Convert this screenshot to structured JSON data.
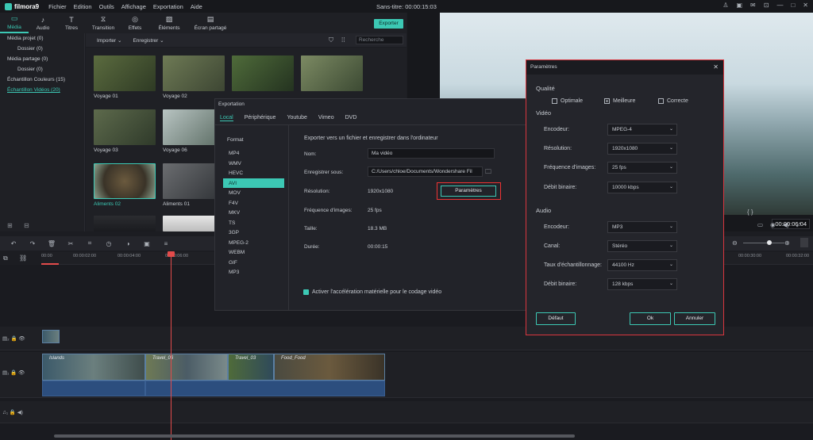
{
  "app": {
    "name": "filmora9",
    "title": "Sans-titre: 00:00:15:03"
  },
  "menu": [
    "Fichier",
    "Edition",
    "Outils",
    "Affichage",
    "Exportation",
    "Aide"
  ],
  "tooltabs": [
    {
      "label": "Média",
      "icon": "folder-icon"
    },
    {
      "label": "Audio",
      "icon": "music-icon"
    },
    {
      "label": "Titres",
      "icon": "text-icon"
    },
    {
      "label": "Transition",
      "icon": "transition-icon"
    },
    {
      "label": "Effets",
      "icon": "effects-icon"
    },
    {
      "label": "Éléments",
      "icon": "image-icon"
    },
    {
      "label": "Écran partagé",
      "icon": "split-screen-icon"
    }
  ],
  "library": {
    "nav": [
      {
        "label": "Média projet (0)",
        "sub": false
      },
      {
        "label": "Dossier (0)",
        "sub": true
      },
      {
        "label": "Média partage (0)",
        "sub": false
      },
      {
        "label": "Dossier (0)",
        "sub": true
      },
      {
        "label": "Échantillon Couleurs (15)",
        "sub": false
      },
      {
        "label": "Échantillon Vidéos (20)",
        "sub": false
      }
    ],
    "import_label": "Importer",
    "record_label": "Enregistrer",
    "search_placeholder": "Recherche",
    "export_button": "Exporter",
    "thumbs": [
      "Voyage 01",
      "Voyage 02",
      "",
      "",
      "Voyage 03",
      "Voyage 06",
      "Aliments 02",
      "Aliments 01"
    ]
  },
  "preview": {
    "timecode": "00:00:06:04",
    "nav_brackets": "{ }"
  },
  "timeline": {
    "ruler": [
      "00:00",
      "00:00:02:00",
      "00:00:04:00",
      "00:00:06:00",
      "00:00:30:00",
      "00:00:32:00"
    ],
    "clips": [
      "Islands",
      "Travel_06",
      "Travel_03",
      "Food_Food"
    ]
  },
  "export": {
    "title": "Exportation",
    "tabs": [
      "Local",
      "Périphérique",
      "Youtube",
      "Vimeo",
      "DVD"
    ],
    "format_header": "Format",
    "formats": [
      "MP4",
      "WMV",
      "HEVC",
      "AVI",
      "MOV",
      "F4V",
      "MKV",
      "TS",
      "3GP",
      "MPEG-2",
      "WEBM",
      "GIF",
      "MP3"
    ],
    "heading": "Exporter vers un fichier et enregistrer dans l'ordinateur",
    "name_label": "Nom:",
    "name_value": "Ma vidéo",
    "save_label": "Enregistrer sous:",
    "save_value": "C:/Users/chloe/Documents/Wondershare Fil",
    "resolution_label": "Résolution:",
    "resolution_value": "1920x1080",
    "params_button": "Paramètres",
    "fps_label": "Fréquence d'images:",
    "fps_value": "25 fps",
    "size_label": "Taille:",
    "size_value": "18.3 MB",
    "duration_label": "Durée:",
    "duration_value": "00:00:15",
    "hw_accel": "Activer l'accélération matérielle pour le codage vidéo"
  },
  "params": {
    "title": "Paramètres",
    "quality_label": "Qualité",
    "quality": [
      "Optimale",
      "Meilleure",
      "Correcte"
    ],
    "video_label": "Vidéo",
    "audio_label": "Audio",
    "video_rows": [
      {
        "label": "Encodeur:",
        "value": "MPEG-4"
      },
      {
        "label": "Résolution:",
        "value": "1920x1080"
      },
      {
        "label": "Fréquence d'images:",
        "value": "25 fps"
      },
      {
        "label": "Débit binaire:",
        "value": "10000 kbps"
      }
    ],
    "audio_rows": [
      {
        "label": "Encodeur:",
        "value": "MP3"
      },
      {
        "label": "Canal:",
        "value": "Stéréo"
      },
      {
        "label": "Taux d'échantillonnage:",
        "value": "44100 Hz"
      },
      {
        "label": "Débit binaire:",
        "value": "128 kbps"
      }
    ],
    "default_button": "Défaut",
    "ok_button": "Ok",
    "cancel_button": "Annuler"
  }
}
